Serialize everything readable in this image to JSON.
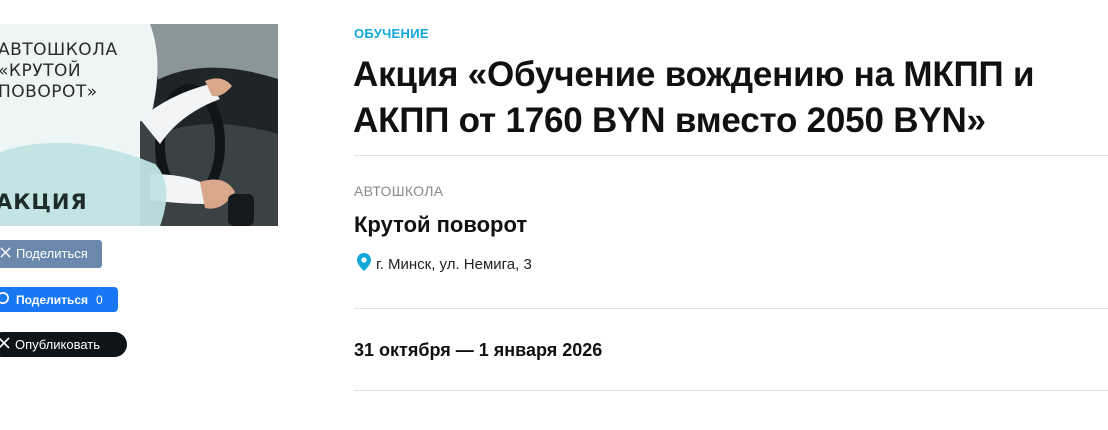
{
  "promo_image": {
    "brand_text": "АВТОШКОЛА\n«КРУТОЙ\nПОВОРОТ»",
    "badge_text": "АКЦИЯ",
    "accent_color": "#bfe3e3"
  },
  "share": {
    "vk_label": "Поделиться",
    "fb_label": "Поделиться",
    "fb_count": "0",
    "x_label": "Опубликовать"
  },
  "article": {
    "category": "ОБУЧЕНИЕ",
    "title": "Акция «Обучение вождению на МКПП и АКПП от 1760 BYN вместо 2050 BYN»",
    "organization_type": "АВТОШКОЛА",
    "organization_name": "Крутой поворот",
    "address": "г. Минск, ул. Немига, 3",
    "dates": "31 октября — 1 января 2026"
  },
  "colors": {
    "category": "#12a7d8",
    "pin": "#12a7d8",
    "vk": "#6a88ab",
    "fb": "#1877f2",
    "x": "#0f1419"
  },
  "icons": [
    "x-logo-icon",
    "facebook-icon",
    "map-pin-icon"
  ]
}
